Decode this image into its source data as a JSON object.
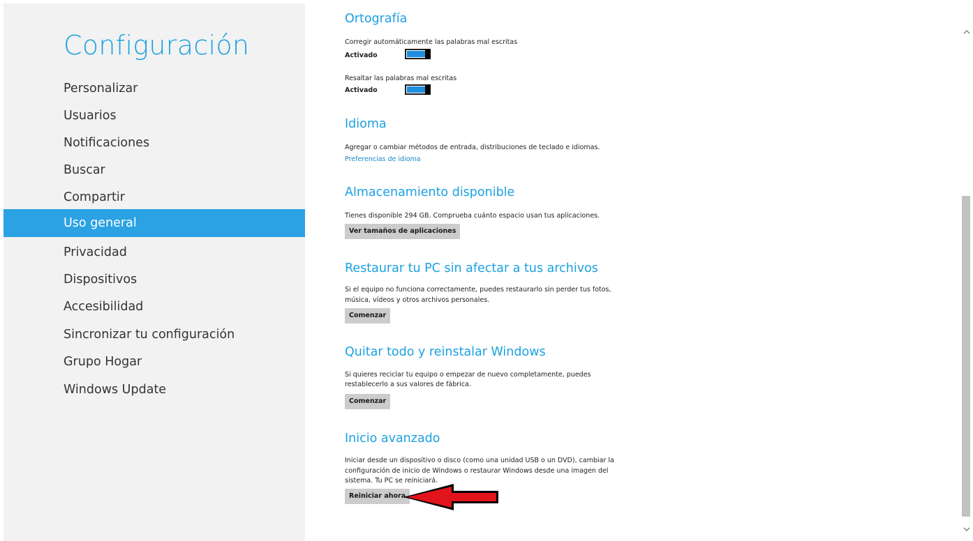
{
  "sidebar": {
    "title": "Configuración",
    "items": [
      {
        "label": "Personalizar"
      },
      {
        "label": "Usuarios"
      },
      {
        "label": "Notificaciones"
      },
      {
        "label": "Buscar"
      },
      {
        "label": "Compartir"
      },
      {
        "label": "Uso general",
        "selected": true
      },
      {
        "label": "Privacidad"
      },
      {
        "label": "Dispositivos"
      },
      {
        "label": "Accesibilidad"
      },
      {
        "label": "Sincronizar tu configuración"
      },
      {
        "label": "Grupo Hogar"
      },
      {
        "label": "Windows Update"
      }
    ]
  },
  "sections": {
    "spelling": {
      "heading": "Ortografía",
      "autocorrect": {
        "label": "Corregir automáticamente las palabras mal escritas",
        "state": "Activado",
        "on": true
      },
      "highlight": {
        "label": "Resaltar las palabras mal escritas",
        "state": "Activado",
        "on": true
      }
    },
    "language": {
      "heading": "Idioma",
      "description": "Agregar o cambiar métodos de entrada, distribuciones de teclado e idiomas.",
      "link": "Preferencias de idioma"
    },
    "storage": {
      "heading": "Almacenamiento disponible",
      "description": "Tienes disponible 294 GB. Comprueba cuánto espacio usan tus aplicaciones.",
      "button": "Ver tamaños de aplicaciones"
    },
    "refresh": {
      "heading": "Restaurar tu PC sin afectar a tus archivos",
      "line1": "Si el equipo no funciona correctamente, puedes restaurarlo sin perder tus fotos,",
      "line2": "música, vídeos y otros archivos personales.",
      "button": "Comenzar"
    },
    "reset": {
      "heading": "Quitar todo y reinstalar Windows",
      "line1": "Si quieres reciclar tu equipo o empezar de nuevo completamente, puedes",
      "line2": "restablecerlo a sus valores de fábrica.",
      "button": "Comenzar"
    },
    "advanced": {
      "heading": "Inicio avanzado",
      "line1": "Iniciar desde un dispositivo o disco (como una unidad USB o un DVD), cambiar la",
      "line2": "configuración de inicio de Windows o restaurar Windows desde una imagen del",
      "line3": "sistema. Tu PC se reiniciará.",
      "button": "Reiniciar ahora"
    }
  },
  "colors": {
    "accent": "#1ba1e2",
    "selected_bg": "#2ba2e4",
    "sidebar_bg": "#f2f2f2",
    "annotation_arrow": "#e2141b"
  },
  "icons": {
    "scroll_up": "chevron-up-icon",
    "scroll_down": "chevron-down-icon",
    "annotation": "red-arrow-icon"
  }
}
